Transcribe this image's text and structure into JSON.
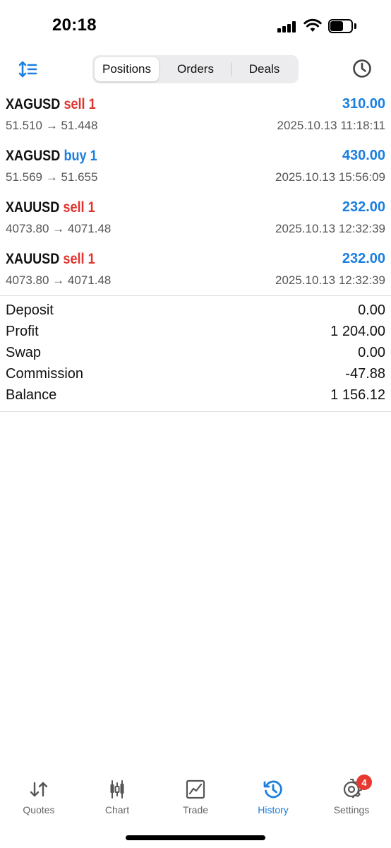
{
  "status_bar": {
    "time": "20:18"
  },
  "toolbar": {
    "tabs": [
      {
        "label": "Positions"
      },
      {
        "label": "Orders"
      },
      {
        "label": "Deals"
      }
    ],
    "accent_color": "#1a7fe0"
  },
  "positions": [
    {
      "symbol": "XAGUSD",
      "side": "sell 1",
      "profit": "310.00",
      "prices": "51.510 → 51.448",
      "time": "2025.10.13 11:18:11"
    },
    {
      "symbol": "XAGUSD",
      "side": "buy 1",
      "profit": "430.00",
      "prices": "51.569 → 51.655",
      "time": "2025.10.13 15:56:09"
    },
    {
      "symbol": "XAUUSD",
      "side": "sell 1",
      "profit": "232.00",
      "prices": "4073.80 → 4071.48",
      "time": "2025.10.13 12:32:39"
    },
    {
      "symbol": "XAUUSD",
      "side": "sell 1",
      "profit": "232.00",
      "prices": "4073.80 → 4071.48",
      "time": "2025.10.13 12:32:39"
    }
  ],
  "summary": [
    {
      "label": "Deposit",
      "value": "0.00"
    },
    {
      "label": "Profit",
      "value": "1 204.00"
    },
    {
      "label": "Swap",
      "value": "0.00"
    },
    {
      "label": "Commission",
      "value": "-47.88"
    },
    {
      "label": "Balance",
      "value": "1 156.12"
    }
  ],
  "tabbar": {
    "tabs": [
      {
        "label": "Quotes",
        "icon": "quotes-icon"
      },
      {
        "label": "Chart",
        "icon": "chart-icon"
      },
      {
        "label": "Trade",
        "icon": "trade-icon"
      },
      {
        "label": "History",
        "icon": "history-icon",
        "active": true
      },
      {
        "label": "Settings",
        "icon": "gear-icon",
        "badge": "4"
      }
    ]
  },
  "colors": {
    "sell": "#e0342e",
    "buy": "#1a7fe0",
    "profit": "#1a7fe0",
    "badge": "#e8382f"
  }
}
